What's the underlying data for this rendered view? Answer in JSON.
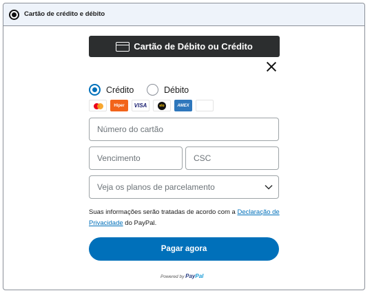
{
  "header": {
    "label": "Cartão de crédito e débito"
  },
  "card_button": {
    "label": "Cartão de Débito ou Crédito"
  },
  "options": {
    "credit": "Crédito",
    "debit": "Débito",
    "selected": "credit"
  },
  "brands": [
    "mastercard",
    "hipercard",
    "visa",
    "elo",
    "amex",
    "blank"
  ],
  "brand_labels": {
    "hiper": "Hiper",
    "visa": "VISA",
    "elo": "elo",
    "amex": "AMEX"
  },
  "fields": {
    "card_number_placeholder": "Número do cartão",
    "expiry_placeholder": "Vencimento",
    "csc_placeholder": "CSC",
    "plans_label": "Veja os planos de parcelamento"
  },
  "disclaimer": {
    "pre": "Suas informações serão tratadas de acordo com a ",
    "link": "Declaração de Privacidade",
    "post": " do PayPal."
  },
  "pay_button": {
    "label": "Pagar agora"
  },
  "powered": {
    "text": "Powered by ",
    "brand1": "Pay",
    "brand2": "Pal"
  },
  "colors": {
    "accent": "#0070ba",
    "dark_button": "#2c2e2f",
    "header_bg": "#eef3fa"
  }
}
